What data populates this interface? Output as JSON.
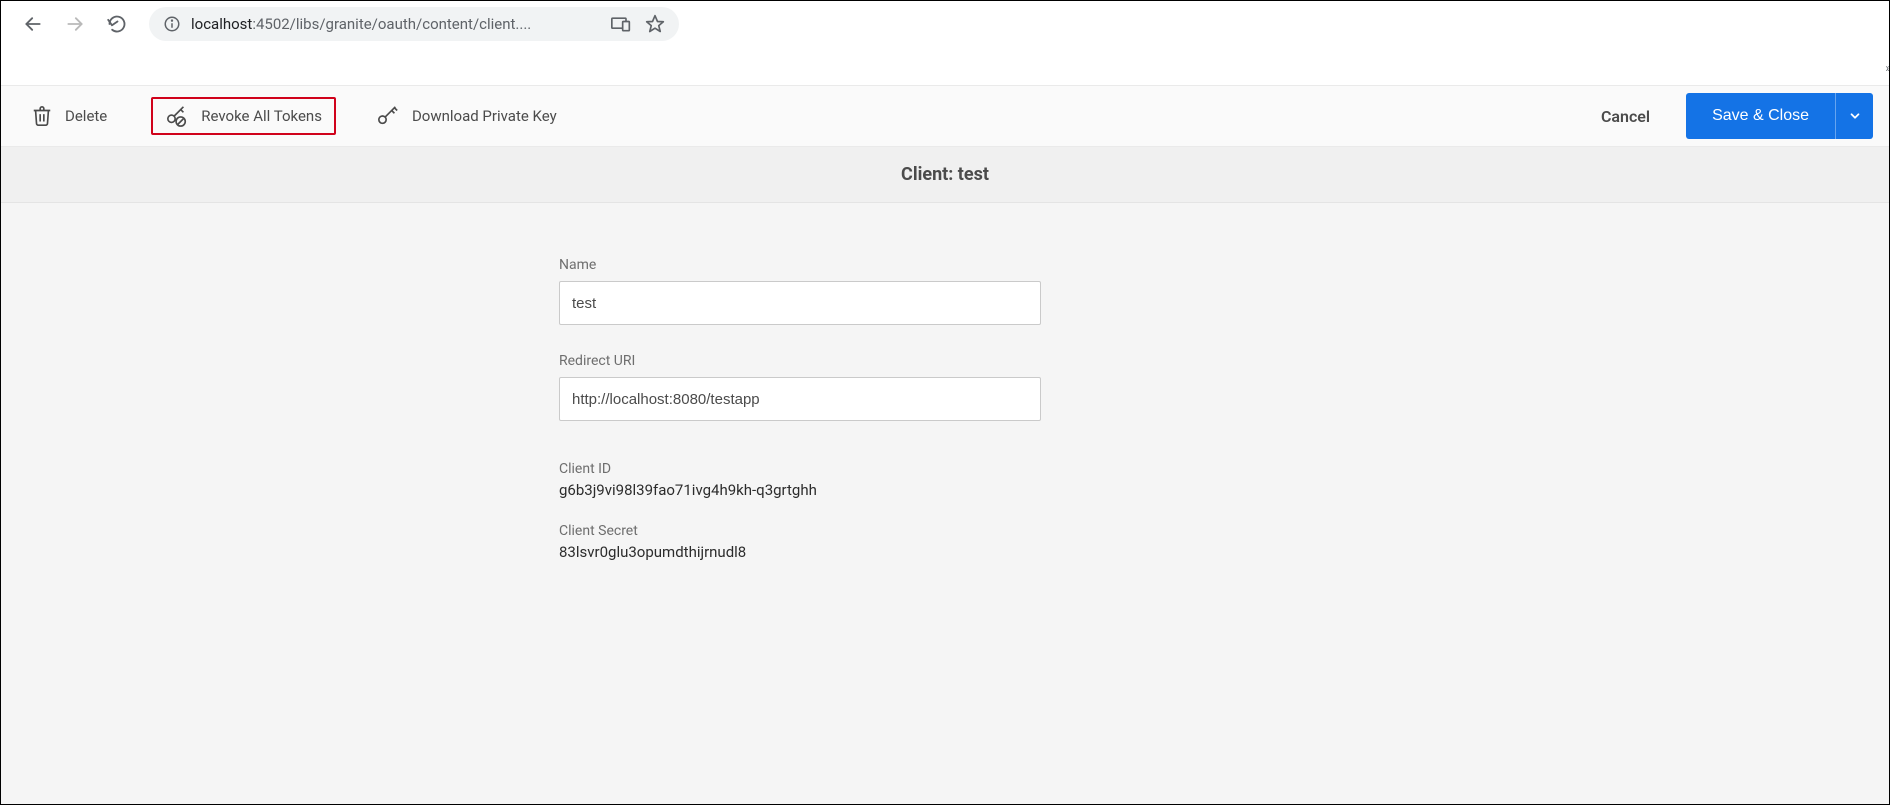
{
  "browser": {
    "url_prefix": "localhost",
    "url_rest": ":4502/libs/granite/oauth/content/client....",
    "full_url": "localhost:4502/libs/granite/oauth/content/client...."
  },
  "toolbar": {
    "delete_label": "Delete",
    "revoke_label": "Revoke All Tokens",
    "download_label": "Download Private Key",
    "cancel_label": "Cancel",
    "save_label": "Save & Close"
  },
  "page": {
    "title": "Client: test"
  },
  "form": {
    "name_label": "Name",
    "name_value": "test",
    "redirect_label": "Redirect URI",
    "redirect_value": "http://localhost:8080/testapp",
    "client_id_label": "Client ID",
    "client_id_value": "g6b3j9vi98l39fao71ivg4h9kh-q3grtghh",
    "client_secret_label": "Client Secret",
    "client_secret_value": "83lsvr0glu3opumdthijrnudl8"
  }
}
